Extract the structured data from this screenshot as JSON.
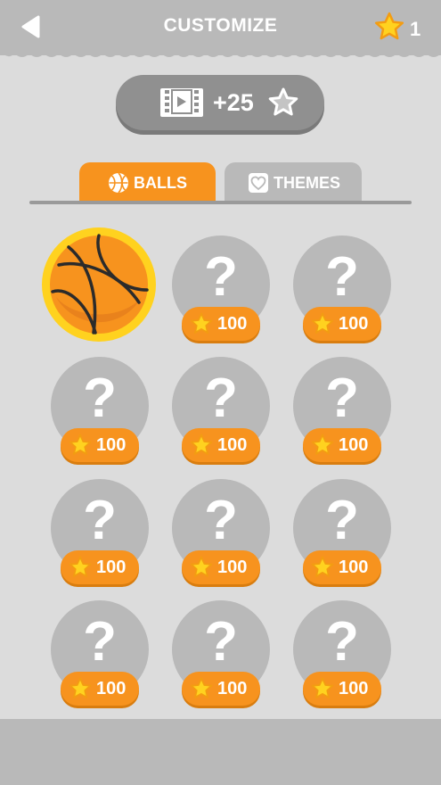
{
  "header": {
    "title": "CUSTOMIZE",
    "star_count": "1",
    "back_icon": "back-arrow-icon",
    "star_icon": "star-icon"
  },
  "video_reward": {
    "reward_label": "+25",
    "film_icon": "video-film-icon",
    "star_icon": "star-outline-icon"
  },
  "tabs": [
    {
      "label": "BALLS",
      "icon": "basketball-icon",
      "active": true
    },
    {
      "label": "THEMES",
      "icon": "heart-icon",
      "active": false
    }
  ],
  "balls": {
    "selected": "basketball",
    "locked_symbol": "?",
    "items": [
      {
        "price": "100"
      },
      {
        "price": "100"
      },
      {
        "price": "100"
      },
      {
        "price": "100"
      },
      {
        "price": "100"
      },
      {
        "price": "100"
      },
      {
        "price": "100"
      },
      {
        "price": "100"
      },
      {
        "price": "100"
      },
      {
        "price": "100"
      },
      {
        "price": "100"
      }
    ]
  },
  "colors": {
    "header_bg": "#b9b9b9",
    "page_bg": "#dcdcdc",
    "accent_orange": "#f7931e",
    "star_yellow": "#ffd21f",
    "locked_gray": "#b9b9b9"
  }
}
